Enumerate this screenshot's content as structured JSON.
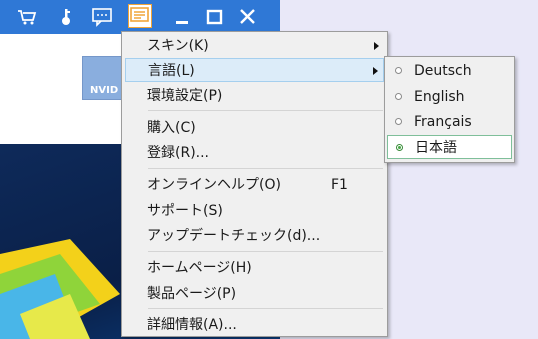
{
  "toolbar": {
    "icons": [
      "cart-icon",
      "key-icon",
      "chat-icon",
      "menu-icon",
      "minimize-icon",
      "maximize-icon",
      "close-icon"
    ],
    "accent": "#2f78d6"
  },
  "badge": {
    "text": "NVID"
  },
  "menu": {
    "items": [
      {
        "label": "スキン(K)"
      },
      {
        "label": "言語(L)"
      },
      {
        "label": "環境設定(P)"
      },
      {
        "label": "購入(C)"
      },
      {
        "label": "登録(R)..."
      },
      {
        "label": "オンラインヘルプ(O)",
        "shortcut": "F1"
      },
      {
        "label": "サポート(S)"
      },
      {
        "label": "アップデートチェック(d)..."
      },
      {
        "label": "ホームページ(H)"
      },
      {
        "label": "製品ページ(P)"
      },
      {
        "label": "詳細情報(A)..."
      }
    ]
  },
  "language_submenu": {
    "items": [
      {
        "label": "Deutsch",
        "selected": false
      },
      {
        "label": "English",
        "selected": false
      },
      {
        "label": "Français",
        "selected": false
      },
      {
        "label": "日本語",
        "selected": true
      }
    ]
  }
}
